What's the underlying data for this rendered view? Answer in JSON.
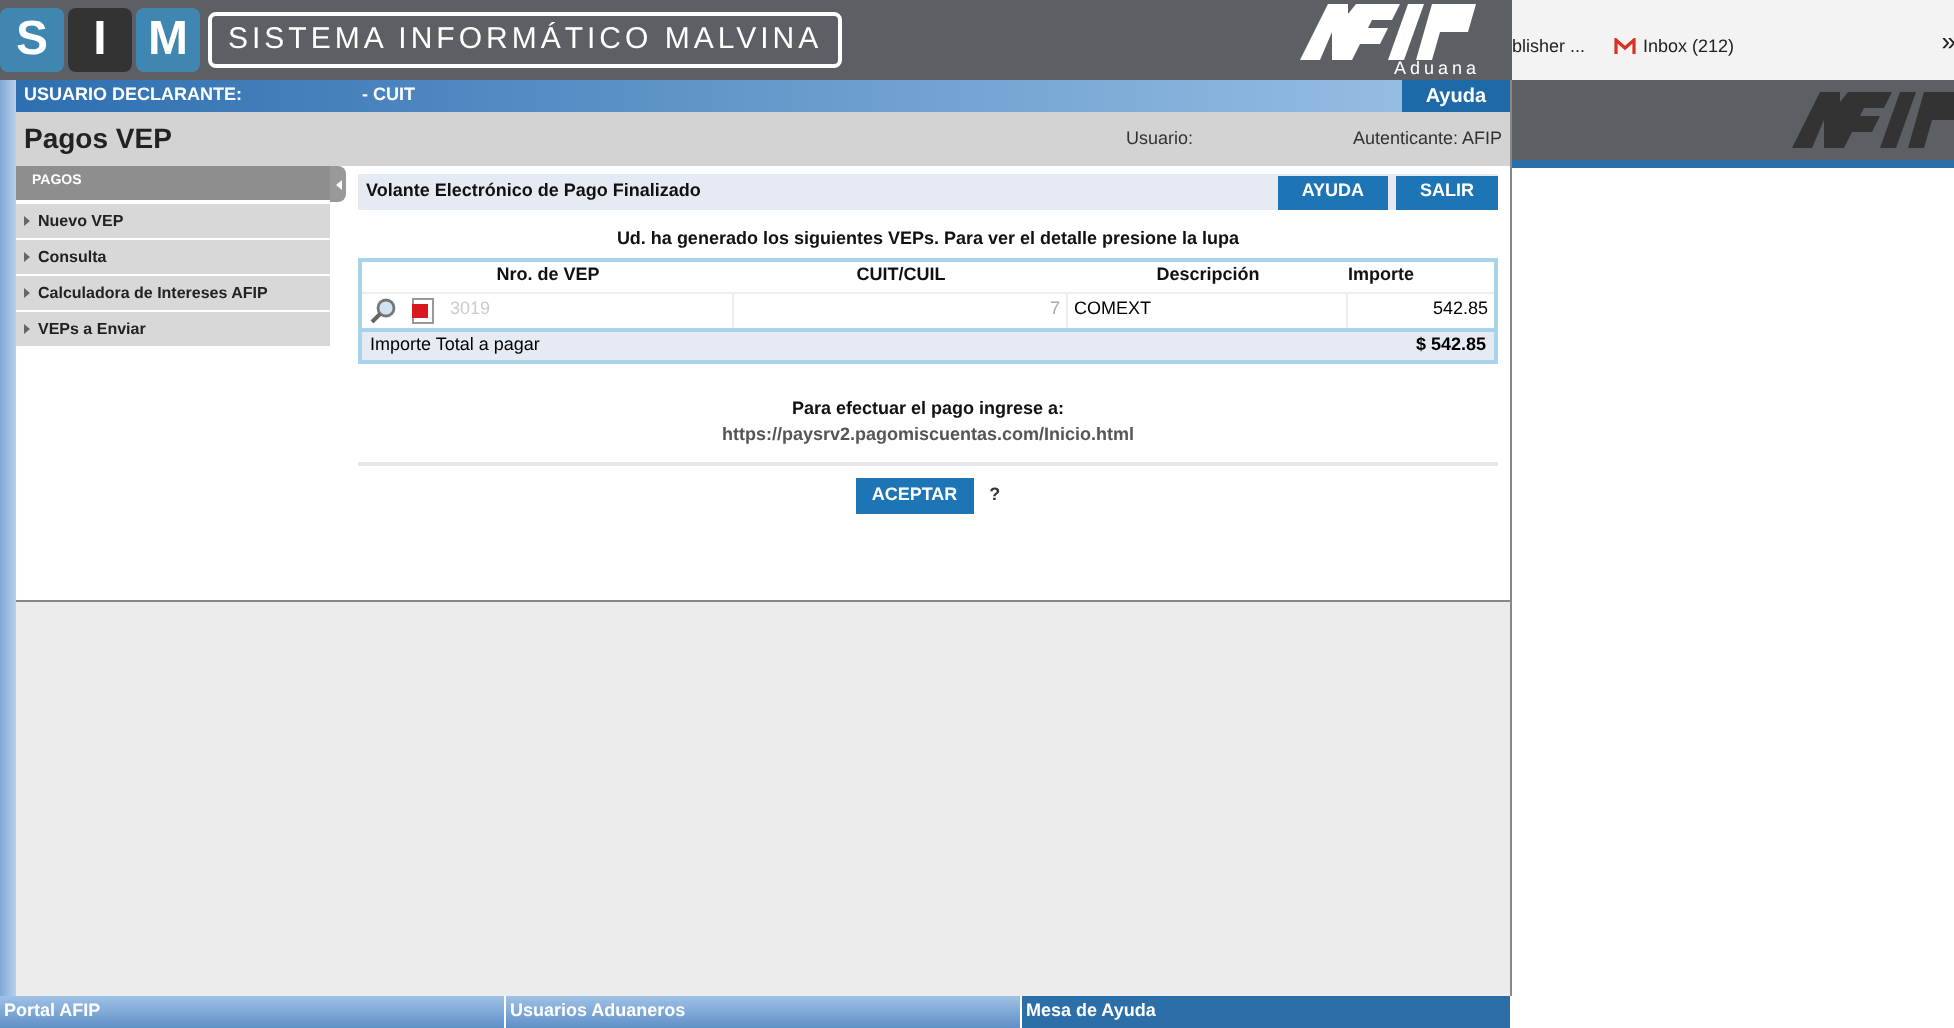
{
  "header": {
    "logo_letters": [
      "S",
      "I",
      "M"
    ],
    "system_name": "SISTEMA INFORMÁTICO MALVINA",
    "brand": "Aduana"
  },
  "user_bar": {
    "label": "USUARIO DECLARANTE:",
    "cuit_label": "- CUIT",
    "help": "Ayuda"
  },
  "page": {
    "title": "Pagos VEP",
    "user_label": "Usuario:",
    "auth": "Autenticante: AFIP"
  },
  "sidebar": {
    "title": "PAGOS",
    "items": [
      {
        "label": "Nuevo VEP",
        "selected": false
      },
      {
        "label": "Consulta",
        "selected": false
      },
      {
        "label": "Calculadora de Intereses AFIP",
        "selected": false
      },
      {
        "label": "VEPs a Enviar",
        "selected": false
      }
    ]
  },
  "panel": {
    "title": "Volante Electrónico de Pago Finalizado",
    "buttons": [
      "AYUDA",
      "SALIR"
    ],
    "intro": "Ud. ha generado los siguientes VEPs. Para ver el detalle presione la lupa"
  },
  "table": {
    "columns": [
      "Nro. de VEP",
      "CUIT/CUIL",
      "Descripción",
      "Importe"
    ],
    "rows": [
      {
        "vep": "3019",
        "cuit": "7",
        "description": "COMEXT",
        "amount": "542.85"
      }
    ],
    "total_label": "Importe Total a pagar",
    "total": "$ 542.85"
  },
  "payment": {
    "text": "Para efectuar el pago ingrese a:",
    "url": "https://paysrv2.pagomiscuentas.com/Inicio.html"
  },
  "actions": {
    "accept": "ACEPTAR",
    "help": "?"
  },
  "footer": [
    "Portal AFIP",
    "Usuarios Aduaneros",
    "Mesa de Ayuda"
  ],
  "browser": {
    "tab_text": "blisher ...",
    "inbox": "Inbox (212)",
    "overflow": "»"
  }
}
